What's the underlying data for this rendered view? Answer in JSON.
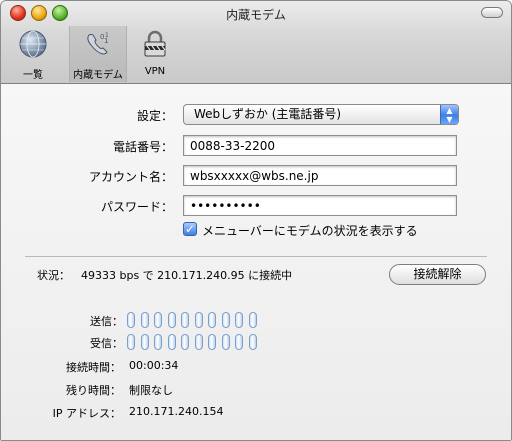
{
  "window": {
    "title": "内蔵モデム"
  },
  "toolbar": {
    "items": [
      {
        "label": "一覧",
        "icon": "globe-icon"
      },
      {
        "label": "内蔵モデム",
        "icon": "modem-phone-icon"
      },
      {
        "label": "VPN",
        "icon": "lock-icon"
      }
    ]
  },
  "form": {
    "config_label": "設定：",
    "config_value": "Webしずおか (主電話番号)",
    "phone_label": "電話番号：",
    "phone_value": "0088-33-2200",
    "account_label": "アカウント名：",
    "account_value": "wbsxxxxx@wbs.ne.jp",
    "password_label": "パスワード：",
    "password_value": "••••••••••",
    "show_in_menubar_label": "メニューバーにモデムの状況を表示する",
    "show_in_menubar_checked": true
  },
  "status": {
    "label": "状況：",
    "text": "49333 bps で 210.171.240.95 に接続中",
    "disconnect_label": "接続解除"
  },
  "meters": {
    "send_label": "送信：",
    "receive_label": "受信：",
    "led_count": 10
  },
  "info": {
    "connect_time_label": "接続時間：",
    "connect_time_value": "00:00:34",
    "remaining_label": "残り時間：",
    "remaining_value": "制限なし",
    "ip_label": "IP アドレス：",
    "ip_value": "210.171.240.154"
  },
  "colors": {
    "accent": "#3d7fe4",
    "led_border": "#7a9fc8"
  }
}
